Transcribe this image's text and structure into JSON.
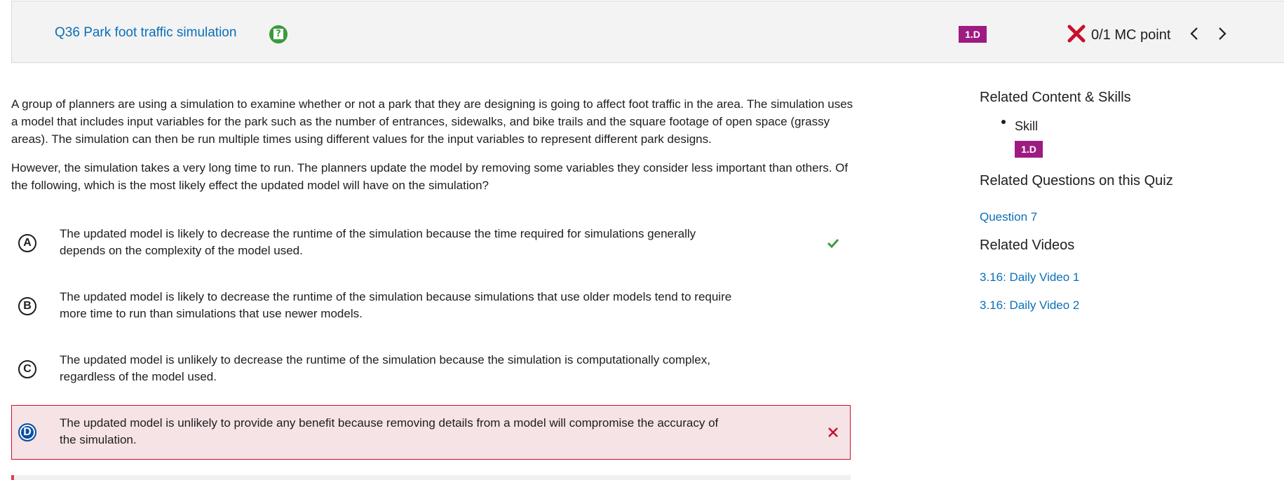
{
  "header": {
    "question_title": "Q36 Park foot traffic simulation",
    "skill_badge": "1.D",
    "score": "0/1 MC point",
    "help_icon": "help-icon",
    "result_icon": "x-icon",
    "prev_icon": "chevron-left-icon",
    "next_icon": "chevron-right-icon"
  },
  "question": {
    "stem_p1": "A group of planners are using a simulation to examine whether or not a park that they are designing is going to affect foot traffic in the area. The simulation uses a model that includes input variables for the park such as the number of entrances, sidewalks, and bike trails and the square footage of open space (grassy areas). The simulation can then be run multiple times using different values for the input variables to represent different park designs.",
    "stem_p2": "However, the simulation takes a very long time to run. The planners update the model by removing some variables they consider less important than others. Of the following, which is the most likely effect the updated model will have on the simulation?",
    "choices": [
      {
        "letter": "A",
        "text": "The updated model is likely to decrease the runtime of the simulation because the time required for simulations generally depends on the complexity of the model used.",
        "status": "correct"
      },
      {
        "letter": "B",
        "text": "The updated model is likely to decrease the runtime of the simulation because simulations that use older models tend to require more time to run than simulations that use newer models.",
        "status": "none"
      },
      {
        "letter": "C",
        "text": "The updated model is unlikely to decrease the runtime of the simulation because the simulation is computationally complex, regardless of the model used.",
        "status": "none"
      },
      {
        "letter": "D",
        "text": "The updated model is unlikely to provide any benefit because removing details from a model will compromise the accuracy of the simulation.",
        "status": "selected-incorrect"
      }
    ]
  },
  "sidebar": {
    "related_content_heading": "Related Content & Skills",
    "skill_label": "Skill",
    "skill_badge": "1.D",
    "related_questions_heading": "Related Questions on this Quiz",
    "related_question_link": "Question 7",
    "related_videos_heading": "Related Videos",
    "videos": [
      "3.16: Daily Video 1",
      "3.16: Daily Video 2"
    ]
  },
  "colors": {
    "link": "#0a6fb8",
    "badge": "#9e1b82",
    "wrong": "#c8102e",
    "correct": "#3c9a3c",
    "wrong_bg": "#f5e3e5",
    "selected": "#0a4fa0"
  }
}
